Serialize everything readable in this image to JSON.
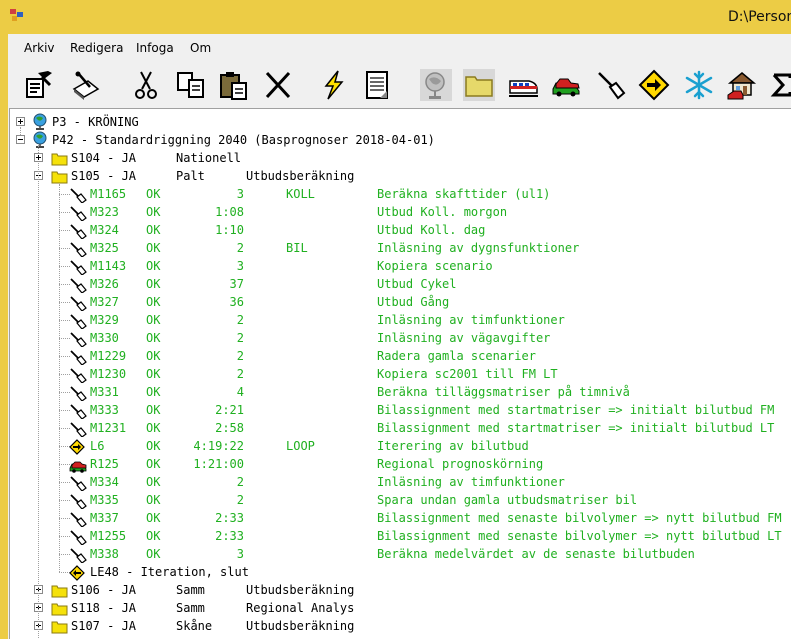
{
  "window": {
    "title": "D:\\Person"
  },
  "menu": [
    "Arkiv",
    "Redigera",
    "Infoga",
    "Om"
  ],
  "toolbar_icons": [
    "properties-icon",
    "edit-icon",
    "cut-icon",
    "copy-icon",
    "paste-icon",
    "delete-icon",
    "run-icon",
    "document-icon",
    "globe-icon",
    "folder-icon",
    "train-icon",
    "car-icon",
    "tool-icon",
    "route-sign-icon",
    "snowflake-icon",
    "house-icon",
    "sum-icon"
  ],
  "tree": {
    "projects": [
      {
        "text": "P3 - KRÖNING",
        "expanded": false
      },
      {
        "text": "P42 - Standardriggning 2040 (Basprognoser 2018-04-01)",
        "expanded": true
      }
    ],
    "scenarios_before": [
      {
        "id": "S104 - JA",
        "region": "Nationell",
        "type": "",
        "expanded": false
      },
      {
        "id": "S105 - JA",
        "region": "Palt",
        "type": "Utbudsberäkning",
        "expanded": true
      }
    ],
    "modules": [
      {
        "icon": "tool",
        "id": "M1165",
        "status": "OK",
        "time": "3",
        "mode": "KOLL",
        "desc": "Beräkna skafttider (ul1)"
      },
      {
        "icon": "tool",
        "id": "M323",
        "status": "OK",
        "time": "1:08",
        "mode": "",
        "desc": "Utbud Koll. morgon"
      },
      {
        "icon": "tool",
        "id": "M324",
        "status": "OK",
        "time": "1:10",
        "mode": "",
        "desc": "Utbud Koll. dag"
      },
      {
        "icon": "tool",
        "id": "M325",
        "status": "OK",
        "time": "2",
        "mode": "BIL",
        "desc": "Inläsning av dygnsfunktioner"
      },
      {
        "icon": "tool",
        "id": "M1143",
        "status": "OK",
        "time": "3",
        "mode": "",
        "desc": "Kopiera scenario"
      },
      {
        "icon": "tool",
        "id": "M326",
        "status": "OK",
        "time": "37",
        "mode": "",
        "desc": "Utbud Cykel"
      },
      {
        "icon": "tool",
        "id": "M327",
        "status": "OK",
        "time": "36",
        "mode": "",
        "desc": "Utbud Gång"
      },
      {
        "icon": "tool",
        "id": "M329",
        "status": "OK",
        "time": "2",
        "mode": "",
        "desc": "Inläsning av timfunktioner"
      },
      {
        "icon": "tool",
        "id": "M330",
        "status": "OK",
        "time": "2",
        "mode": "",
        "desc": "Inläsning av vägavgifter"
      },
      {
        "icon": "tool",
        "id": "M1229",
        "status": "OK",
        "time": "2",
        "mode": "",
        "desc": "Radera gamla scenarier"
      },
      {
        "icon": "tool",
        "id": "M1230",
        "status": "OK",
        "time": "2",
        "mode": "",
        "desc": "Kopiera sc2001 till FM LT"
      },
      {
        "icon": "tool",
        "id": "M331",
        "status": "OK",
        "time": "4",
        "mode": "",
        "desc": "Beräkna tilläggsmatriser på timnivå"
      },
      {
        "icon": "tool",
        "id": "M333",
        "status": "OK",
        "time": "2:21",
        "mode": "",
        "desc": "Bilassignment med startmatriser => initialt bilutbud FM"
      },
      {
        "icon": "tool",
        "id": "M1231",
        "status": "OK",
        "time": "2:58",
        "mode": "",
        "desc": "Bilassignment med startmatriser => initialt bilutbud LT"
      },
      {
        "icon": "loop",
        "id": "L6",
        "status": "OK",
        "time": "4:19:22",
        "mode": "LOOP",
        "desc": "Iterering av bilutbud"
      },
      {
        "icon": "car",
        "id": "R125",
        "status": "OK",
        "time": "1:21:00",
        "mode": "",
        "desc": "Regional prognoskörning"
      },
      {
        "icon": "tool",
        "id": "M334",
        "status": "OK",
        "time": "2",
        "mode": "",
        "desc": "Inläsning av timfunktioner"
      },
      {
        "icon": "tool",
        "id": "M335",
        "status": "OK",
        "time": "2",
        "mode": "",
        "desc": "Spara undan gamla utbudsmatriser bil"
      },
      {
        "icon": "tool",
        "id": "M337",
        "status": "OK",
        "time": "2:33",
        "mode": "",
        "desc": "Bilassignment med senaste bilvolymer => nytt bilutbud FM"
      },
      {
        "icon": "tool",
        "id": "M1255",
        "status": "OK",
        "time": "2:33",
        "mode": "",
        "desc": "Bilassignment med senaste bilvolymer => nytt bilutbud LT"
      },
      {
        "icon": "tool",
        "id": "M338",
        "status": "OK",
        "time": "3",
        "mode": "",
        "desc": "Beräkna medelvärdet av de senaste bilutbuden"
      }
    ],
    "loop_end": {
      "text": "LE48 - Iteration, slut"
    },
    "scenarios_after": [
      {
        "id": "S106 - JA",
        "region": "Samm",
        "type": "Utbudsberäkning",
        "expanded": false
      },
      {
        "id": "S118 - JA",
        "region": "Samm",
        "type": "Regional Analys",
        "expanded": false
      },
      {
        "id": "S107 - JA",
        "region": "Skåne",
        "type": "Utbudsberäkning",
        "expanded": false
      }
    ]
  },
  "colors": {
    "title_bar": "#eccc45",
    "ok_text": "#20b020",
    "folder": "#f5e10a"
  }
}
